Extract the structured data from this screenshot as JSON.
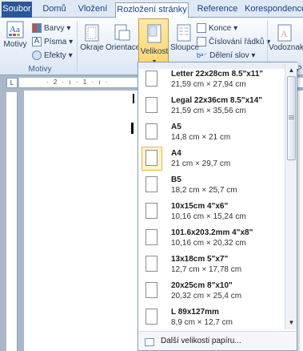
{
  "tabs": [
    {
      "label": "Soubor"
    },
    {
      "label": "Domů"
    },
    {
      "label": "Vložení"
    },
    {
      "label": "Rozložení stránky"
    },
    {
      "label": "Reference"
    },
    {
      "label": "Korespondence"
    }
  ],
  "ribbon": {
    "motivy": "Motivy",
    "barvy": "Barvy ▾",
    "pisma": "Písma ▾",
    "efekty": "Efekty ▾",
    "group_motivy": "Motivy",
    "okraje": "Okraje",
    "orientace": "Orientace",
    "velikost": "Velikost",
    "sloupce": "Sloupce",
    "konce": "Konce ▾",
    "cislovani": "Číslování řádků ▾",
    "deleni": "Dělení slov ▾",
    "vodoznak": "Vodoznak",
    "p_label": "P"
  },
  "ruler": {
    "marks": "· 2 · ı · 1 · ı ·",
    "corner": "L"
  },
  "dropdown": {
    "items": [
      {
        "name": "Letter 22x28cm 8.5\"x11\"",
        "size": "21,59 cm × 27,94 cm"
      },
      {
        "name": "Legal 22x36cm 8.5\"x14\"",
        "size": "21,59 cm × 35,56 cm"
      },
      {
        "name": "A5",
        "size": "14,8 cm × 21 cm"
      },
      {
        "name": "A4",
        "size": "21 cm × 29,7 cm"
      },
      {
        "name": "B5",
        "size": "18,2 cm × 25,7 cm"
      },
      {
        "name": "10x15cm 4\"x6\"",
        "size": "10,16 cm × 15,24 cm"
      },
      {
        "name": "101.6x203.2mm 4\"x8\"",
        "size": "10,16 cm × 20,32 cm"
      },
      {
        "name": "13x18cm 5\"x7\"",
        "size": "12,7 cm × 17,78 cm"
      },
      {
        "name": "20x25cm 8\"x10\"",
        "size": "20,32 cm × 25,4 cm"
      },
      {
        "name": "L 89x127mm",
        "size": "8,9 cm × 12,7 cm"
      }
    ],
    "selected_index": 3,
    "more_label": "Další velikosti papíru..."
  }
}
